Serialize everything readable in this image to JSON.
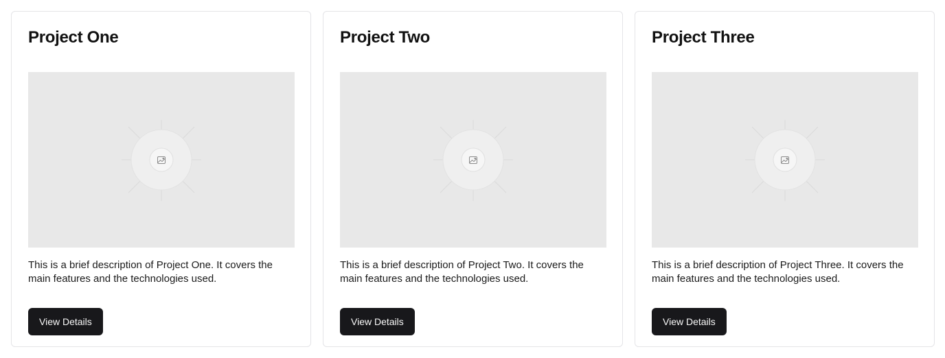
{
  "projects": [
    {
      "title": "Project One",
      "description": "This is a brief description of Project One. It covers the main features and the technologies used.",
      "button_label": "View Details",
      "image_icon": "image-placeholder-icon"
    },
    {
      "title": "Project Two",
      "description": "This is a brief description of Project Two. It covers the main features and the technologies used.",
      "button_label": "View Details",
      "image_icon": "image-placeholder-icon"
    },
    {
      "title": "Project Three",
      "description": "This is a brief description of Project Three. It covers the main features and the technologies used.",
      "button_label": "View Details",
      "image_icon": "image-placeholder-icon"
    }
  ],
  "colors": {
    "card_border": "#e4e4e7",
    "placeholder_bg": "#e8e8e8",
    "button_bg": "#18181b",
    "button_text": "#fafafa"
  }
}
